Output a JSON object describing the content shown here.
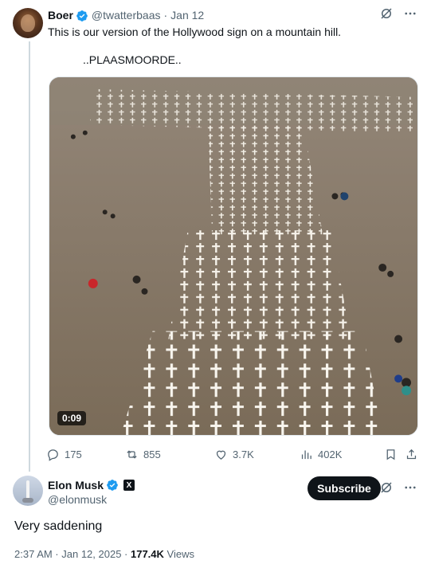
{
  "original_tweet": {
    "display_name": "Boer",
    "handle": "@twatterbaas",
    "date": "Jan 12",
    "text_line1": "This is our version of the Hollywood sign on a mountain hill.",
    "text_line2": "..PLAASMOORDE..",
    "video_duration": "0:09",
    "stats": {
      "replies": "175",
      "reposts": "855",
      "likes": "3.7K",
      "views": "402K"
    }
  },
  "reply_tweet": {
    "display_name": "Elon Musk",
    "affiliation_badge": "X",
    "handle": "@elonmusk",
    "subscribe_label": "Subscribe",
    "text": "Very saddening",
    "timestamp": "2:37 AM · Jan 12, 2025 · ",
    "views_count": "177.4K",
    "views_label": " Views"
  },
  "colors": {
    "verified_blue": "#1d9bf0",
    "text_primary": "#0f1419",
    "text_secondary": "#536471",
    "thread_line": "#cfd9de"
  },
  "icons": [
    "grok-icon",
    "more-icon",
    "reply-icon",
    "repost-icon",
    "like-icon",
    "views-icon",
    "bookmark-icon",
    "share-icon",
    "verified-icon"
  ]
}
